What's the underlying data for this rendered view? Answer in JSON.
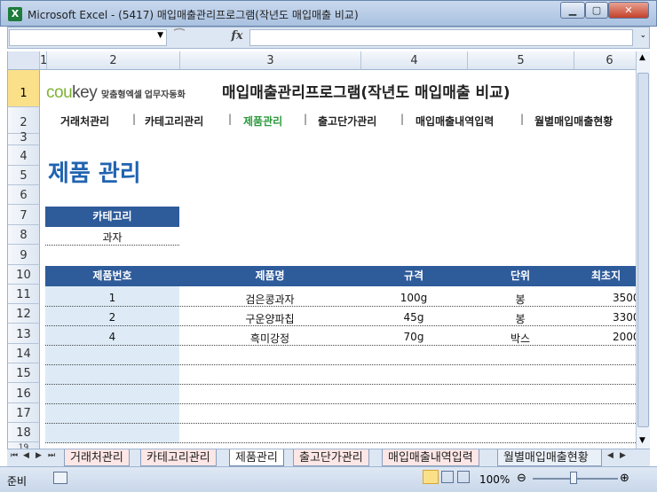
{
  "window": {
    "title": "Microsoft Excel - (5417) 매입매출관리프로그램(작년도 매입매출 비교)",
    "app_icon": "excel-icon",
    "min_label": "▁",
    "max_label": "▢",
    "close_label": "✕"
  },
  "formula_bar": {
    "name_box": "",
    "fx_label": "fx",
    "value": ""
  },
  "columns": [
    "1",
    "2",
    "3",
    "4",
    "5",
    "6"
  ],
  "rows": [
    "1",
    "2",
    "3",
    "4",
    "5",
    "6",
    "7",
    "8",
    "9",
    "10",
    "11",
    "12",
    "13",
    "14",
    "15",
    "16",
    "17",
    "18",
    "19"
  ],
  "header": {
    "logo_cou": "cou",
    "logo_key": "key",
    "logo_sub": "맞춤형엑셀 업무자동화",
    "app_title": "매입매출관리프로그램(작년도 매입매출 비교)"
  },
  "nav": [
    {
      "label": "거래처관리",
      "active": false
    },
    {
      "label": "카테고리관리",
      "active": false
    },
    {
      "label": "제품관리",
      "active": true
    },
    {
      "label": "출고단가관리",
      "active": false
    },
    {
      "label": "매입매출내역입력",
      "active": false
    },
    {
      "label": "월별매입매출현황",
      "active": false
    }
  ],
  "nav_separator": "|",
  "page_title": "제품 관리",
  "category": {
    "header": "카테고리",
    "value": "과자"
  },
  "table": {
    "headers": [
      "제품번호",
      "제품명",
      "규격",
      "단위",
      "최초지"
    ],
    "rows": [
      [
        "1",
        "검은콩과자",
        "100g",
        "봉",
        "3500"
      ],
      [
        "2",
        "구운양파칩",
        "45g",
        "봉",
        "3300"
      ],
      [
        "4",
        "흑미강정",
        "70g",
        "박스",
        "2000"
      ]
    ]
  },
  "sheet_tabs": [
    {
      "label": "거래처관리",
      "active": false
    },
    {
      "label": "카테고리관리",
      "active": false
    },
    {
      "label": "제품관리",
      "active": true
    },
    {
      "label": "출고단가관리",
      "active": false
    },
    {
      "label": "매입매출내역입력",
      "active": false
    },
    {
      "label": "월별매입매출현황",
      "active": false
    }
  ],
  "status": {
    "mode": "준비",
    "zoom": "100%"
  },
  "colors": {
    "header_blue": "#2e5b9a",
    "title_blue": "#2163b0",
    "active_green": "#2d9a3e",
    "selected_row": "#fbe08a",
    "light_blue": "#deebf7"
  }
}
